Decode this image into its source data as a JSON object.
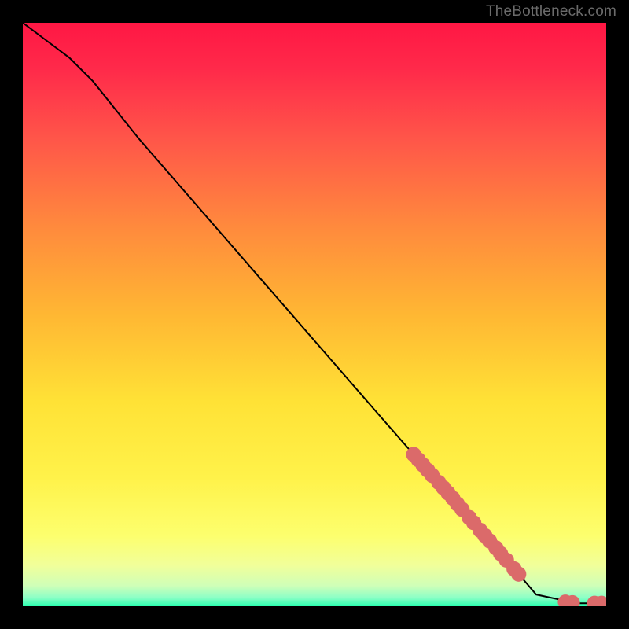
{
  "watermark": "TheBottleneck.com",
  "chart_data": {
    "type": "line",
    "title": "",
    "xlabel": "",
    "ylabel": "",
    "xlim": [
      0,
      100
    ],
    "ylim": [
      0,
      100
    ],
    "grid": false,
    "legend": false,
    "line": {
      "name": "curve",
      "x": [
        0,
        4,
        8,
        12,
        20,
        30,
        40,
        50,
        60,
        67,
        85,
        88,
        95,
        100
      ],
      "y": [
        100,
        97,
        94,
        90,
        80,
        68.5,
        57,
        45.5,
        34,
        26,
        5.5,
        2,
        0.5,
        0.5
      ]
    },
    "markers": {
      "name": "highlighted-points",
      "color": "#db6a6a",
      "radius": 1.3,
      "points": [
        {
          "x": 67.0,
          "y": 26.0
        },
        {
          "x": 67.8,
          "y": 25.1
        },
        {
          "x": 68.6,
          "y": 24.2
        },
        {
          "x": 69.4,
          "y": 23.3
        },
        {
          "x": 70.2,
          "y": 22.4
        },
        {
          "x": 71.3,
          "y": 21.2
        },
        {
          "x": 72.1,
          "y": 20.3
        },
        {
          "x": 72.9,
          "y": 19.4
        },
        {
          "x": 73.7,
          "y": 18.5
        },
        {
          "x": 74.5,
          "y": 17.5
        },
        {
          "x": 75.3,
          "y": 16.6
        },
        {
          "x": 76.5,
          "y": 15.2
        },
        {
          "x": 77.3,
          "y": 14.3
        },
        {
          "x": 78.4,
          "y": 13.0
        },
        {
          "x": 79.2,
          "y": 12.1
        },
        {
          "x": 80.0,
          "y": 11.2
        },
        {
          "x": 81.1,
          "y": 10.0
        },
        {
          "x": 81.9,
          "y": 9.0
        },
        {
          "x": 82.9,
          "y": 7.9
        },
        {
          "x": 84.2,
          "y": 6.4
        },
        {
          "x": 85.0,
          "y": 5.5
        },
        {
          "x": 93.0,
          "y": 0.7
        },
        {
          "x": 94.2,
          "y": 0.6
        },
        {
          "x": 98.0,
          "y": 0.5
        },
        {
          "x": 99.2,
          "y": 0.5
        }
      ]
    },
    "background_gradient": {
      "stops": [
        {
          "offset": 0.0,
          "color": "#ff1744"
        },
        {
          "offset": 0.08,
          "color": "#ff2a4a"
        },
        {
          "offset": 0.2,
          "color": "#ff5649"
        },
        {
          "offset": 0.35,
          "color": "#ff8a3d"
        },
        {
          "offset": 0.5,
          "color": "#ffb733"
        },
        {
          "offset": 0.65,
          "color": "#ffe236"
        },
        {
          "offset": 0.78,
          "color": "#fff24a"
        },
        {
          "offset": 0.88,
          "color": "#fdff6e"
        },
        {
          "offset": 0.93,
          "color": "#f1ff9a"
        },
        {
          "offset": 0.965,
          "color": "#cfffb8"
        },
        {
          "offset": 0.985,
          "color": "#8dffc6"
        },
        {
          "offset": 1.0,
          "color": "#2bffb0"
        }
      ]
    }
  }
}
